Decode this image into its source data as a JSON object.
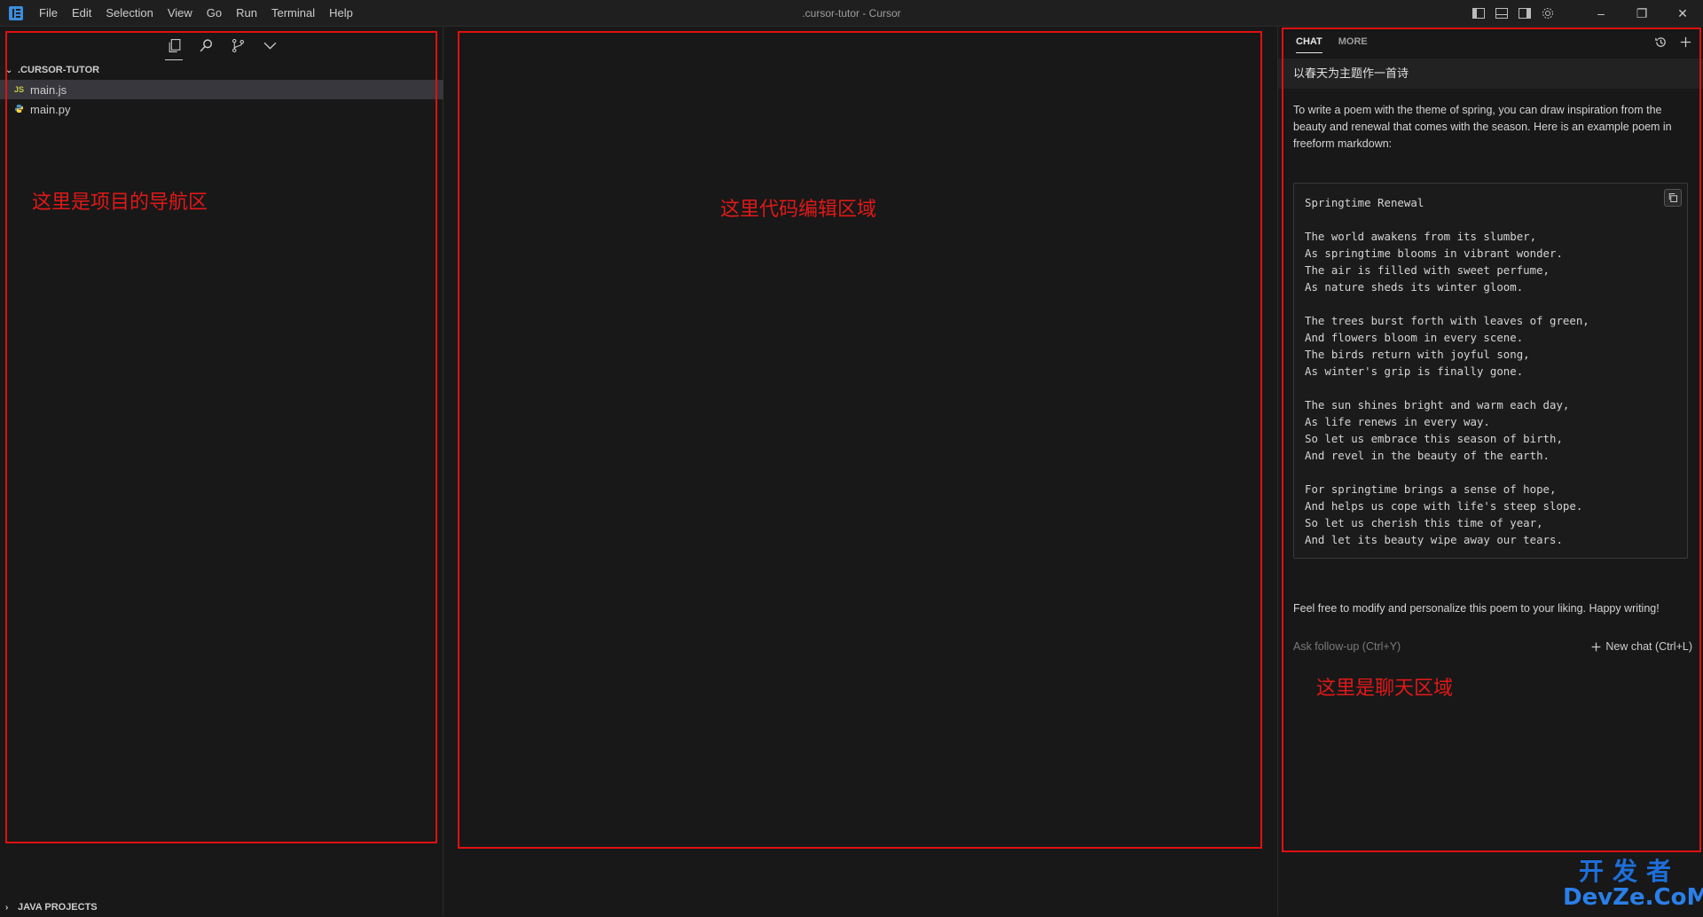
{
  "titlebar": {
    "menu": [
      "File",
      "Edit",
      "Selection",
      "View",
      "Go",
      "Run",
      "Terminal",
      "Help"
    ],
    "window_title": ".cursor-tutor - Cursor",
    "window_controls": {
      "minimize": "–",
      "restore": "❐",
      "close": "✕"
    }
  },
  "sidebar": {
    "folder_name": ".CURSOR-TUTOR",
    "files": [
      {
        "name": "main.js",
        "icon": "JS",
        "selected": true
      },
      {
        "name": "main.py",
        "icon": "py",
        "selected": false
      }
    ],
    "bottom_section": "JAVA PROJECTS"
  },
  "annotations": {
    "nav": "这里是项目的导航区",
    "editor": "这里代码编辑区域",
    "chat": "这里是聊天区域",
    "color": "#e01010"
  },
  "chat": {
    "tabs": [
      "CHAT",
      "MORE"
    ],
    "user_message": "以春天为主题作一首诗",
    "intro": "To write a poem with the theme of spring, you can draw inspiration from the beauty and renewal that comes with the season. Here is an example poem in freeform markdown:",
    "poem": "Springtime Renewal\n\nThe world awakens from its slumber,\nAs springtime blooms in vibrant wonder.\nThe air is filled with sweet perfume,\nAs nature sheds its winter gloom.\n\nThe trees burst forth with leaves of green,\nAnd flowers bloom in every scene.\nThe birds return with joyful song,\nAs winter's grip is finally gone.\n\nThe sun shines bright and warm each day,\nAs life renews in every way.\nSo let us embrace this season of birth,\nAnd revel in the beauty of the earth.\n\nFor springtime brings a sense of hope,\nAnd helps us cope with life's steep slope.\nSo let us cherish this time of year,\nAnd let its beauty wipe away our tears.",
    "outro": "Feel free to modify and personalize this poem to your liking. Happy writing!",
    "followup_placeholder": "Ask follow-up (Ctrl+Y)",
    "new_chat": "New chat (Ctrl+L)"
  },
  "watermark": {
    "line1": "开发者",
    "line2": "DevZe.CoM"
  },
  "colors": {
    "background": "#181818",
    "titlebar": "#1f1f1f",
    "selected_row": "#37373d",
    "annotation_red": "#e01010",
    "watermark_blue": "#1e6fd9"
  }
}
